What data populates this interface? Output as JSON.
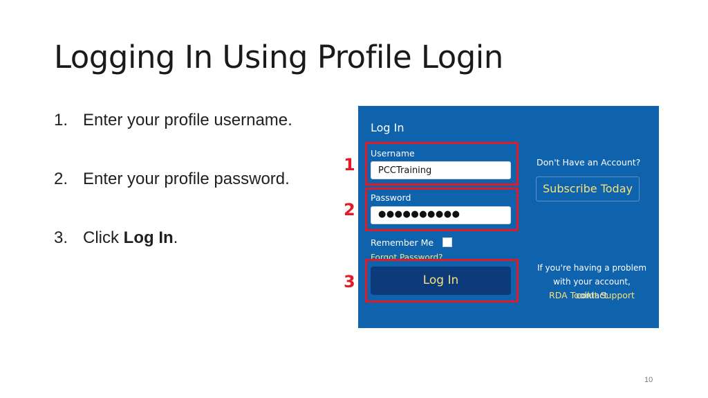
{
  "slide": {
    "title": "Logging In Using Profile Login",
    "page_number": "10"
  },
  "steps": [
    {
      "num": "1.",
      "text": "Enter your profile username.",
      "bold": ""
    },
    {
      "num": "2.",
      "text": "Enter your profile password.",
      "bold": ""
    },
    {
      "num": "3.",
      "text": "Click ",
      "bold": "Log In",
      "suffix": "."
    }
  ],
  "login_panel": {
    "heading": "Log In",
    "username_label": "Username",
    "username_value": "PCCTraining",
    "password_label": "Password",
    "password_value": "●●●●●●●●●●",
    "remember_label": "Remember Me",
    "forgot_label": "Forgot Password?",
    "login_button": "Log In",
    "no_account": "Don't Have an Account?",
    "subscribe_button": "Subscribe Today",
    "help_text": "If you're having a problem with your account, contact",
    "help_link": "RDA Toolkit Support"
  },
  "callouts": [
    "1",
    "2",
    "3"
  ],
  "colors": {
    "panel_bg": "#0f63ad",
    "button_bg": "#0d3a7a",
    "accent_yellow": "#f5e27a",
    "callout_red": "#e21a23"
  }
}
